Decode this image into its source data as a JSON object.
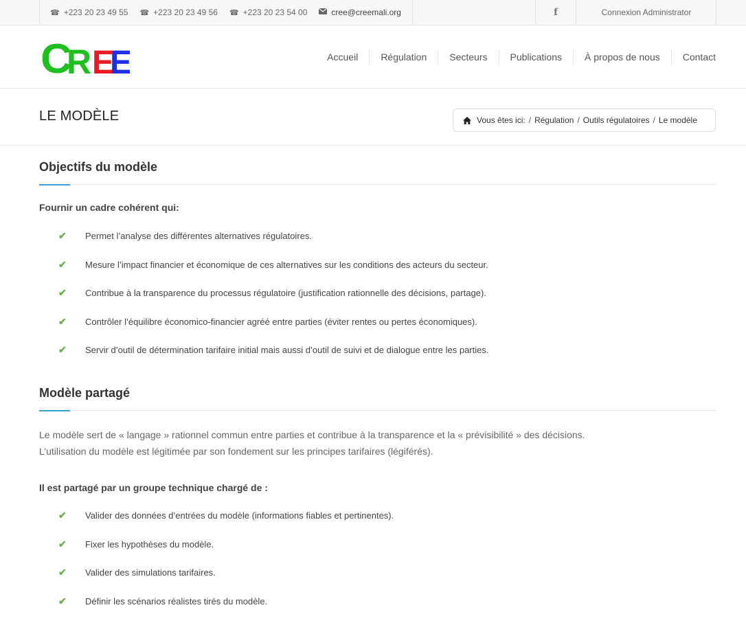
{
  "topbar": {
    "phones": [
      "+223 20 23 49 55",
      "+223 20 23 49 56",
      "+223 20 23 54 00"
    ],
    "email": "cree@creemali.org",
    "facebook_icon": "facebook-icon",
    "facebook_glyph": "f",
    "admin_label": "Connexion Administrator"
  },
  "header": {
    "logo_text": "CREE",
    "logo_colors": [
      "#1fbf1f",
      "#ea1b22",
      "#1f2fe8"
    ],
    "nav": [
      "Accueil",
      "Régulation",
      "Secteurs",
      "Publications",
      "À propos de nous",
      "Contact"
    ]
  },
  "page": {
    "title": "LE MODÈLE",
    "breadcrumb": {
      "lead": "Vous êtes ici:",
      "items": [
        "Régulation",
        "Outils régulatoires",
        "Le modèle"
      ]
    }
  },
  "section1": {
    "title": "Objectifs du modèle",
    "subhead": "Fournir un cadre cohérent qui:",
    "items": [
      "Permet l’analyse des différentes alternatives régulatoires.",
      "Mesure l’impact financier et économique de ces alternatives sur les conditions des acteurs du secteur.",
      "Contribue à la transparence du processus régulatoire (justification rationnelle des décisions, partage).",
      "Contrôler l’équilibre économico-financier agréé entre parties (éviter rentes ou pertes économiques).",
      "Servir d’outil de détermination tarifaire initial mais aussi d’outil de suivi et de dialogue entre les parties."
    ]
  },
  "section2": {
    "title": "Modèle partagé",
    "para1": "Le modèle sert de « langage » rationnel commun entre parties et contribue à la transparence et la « prévisibilité » des décisions.",
    "para2": "L’utilisation du modèle est légitimée par son fondement sur les principes tarifaires (légiférés).",
    "subhead": "Il est partagé par un groupe technique chargé de :",
    "items": [
      "Valider des données d’entrées du modèle (informations fiables et pertinentes).",
      "Fixer les hypothèses du modèle.",
      "Valider des simulations tarifaires.",
      "Définir les scénarios réalistes tirés du modèle."
    ]
  },
  "colors": {
    "accent": "#3aa0d8",
    "check": "#6ab04c"
  }
}
